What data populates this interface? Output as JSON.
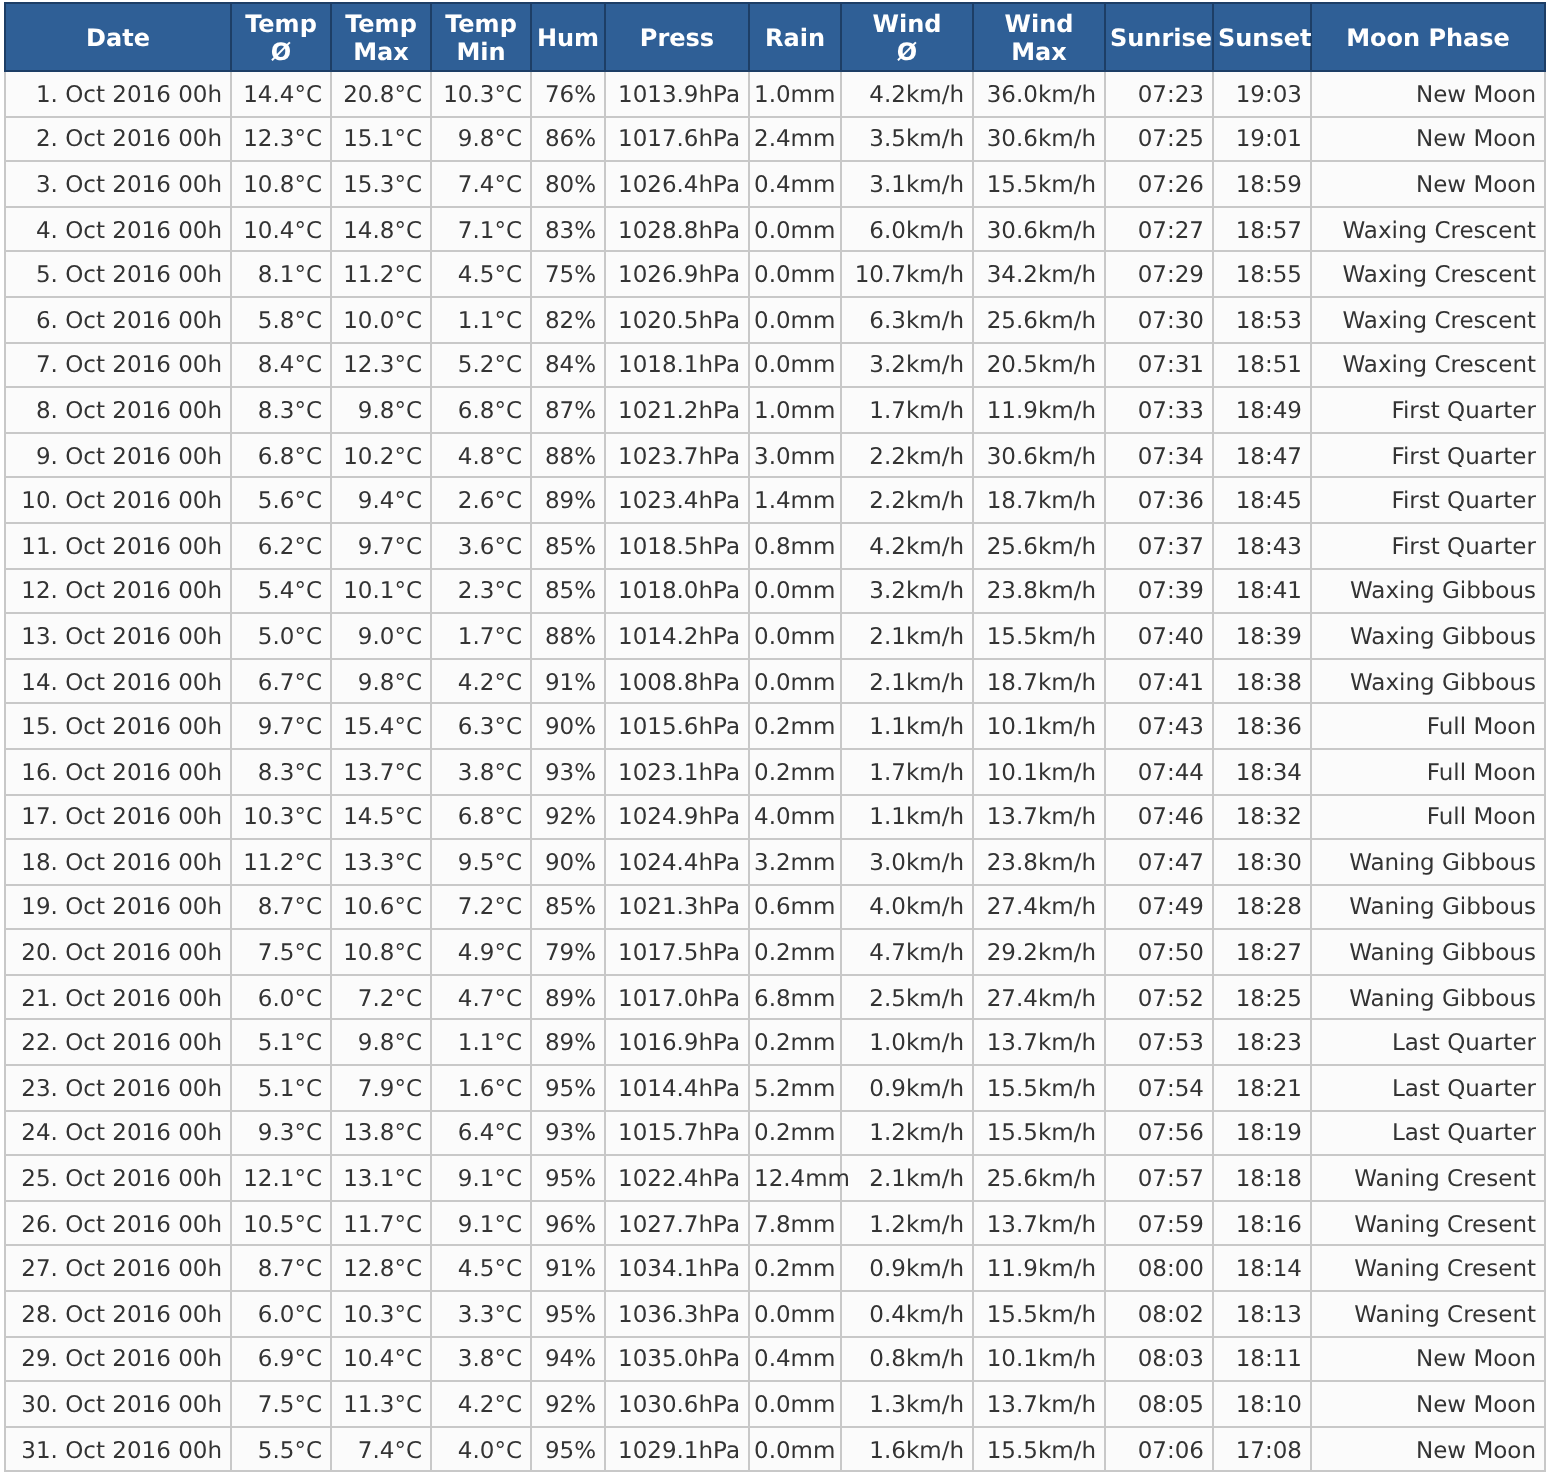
{
  "table": {
    "columns": [
      "Date",
      "Temp Ø",
      "Temp Max",
      "Temp Min",
      "Hum",
      "Press",
      "Rain",
      "Wind Ø",
      "Wind Max",
      "Sunrise",
      "Sunset",
      "Moon Phase"
    ],
    "rows": [
      [
        "1. Oct 2016 00h",
        "14.4°C",
        "20.8°C",
        "10.3°C",
        "76%",
        "1013.9hPa",
        "1.0mm",
        "4.2km/h",
        "36.0km/h",
        "07:23",
        "19:03",
        "New Moon"
      ],
      [
        "2. Oct 2016 00h",
        "12.3°C",
        "15.1°C",
        "9.8°C",
        "86%",
        "1017.6hPa",
        "2.4mm",
        "3.5km/h",
        "30.6km/h",
        "07:25",
        "19:01",
        "New Moon"
      ],
      [
        "3. Oct 2016 00h",
        "10.8°C",
        "15.3°C",
        "7.4°C",
        "80%",
        "1026.4hPa",
        "0.4mm",
        "3.1km/h",
        "15.5km/h",
        "07:26",
        "18:59",
        "New Moon"
      ],
      [
        "4. Oct 2016 00h",
        "10.4°C",
        "14.8°C",
        "7.1°C",
        "83%",
        "1028.8hPa",
        "0.0mm",
        "6.0km/h",
        "30.6km/h",
        "07:27",
        "18:57",
        "Waxing Crescent"
      ],
      [
        "5. Oct 2016 00h",
        "8.1°C",
        "11.2°C",
        "4.5°C",
        "75%",
        "1026.9hPa",
        "0.0mm",
        "10.7km/h",
        "34.2km/h",
        "07:29",
        "18:55",
        "Waxing Crescent"
      ],
      [
        "6. Oct 2016 00h",
        "5.8°C",
        "10.0°C",
        "1.1°C",
        "82%",
        "1020.5hPa",
        "0.0mm",
        "6.3km/h",
        "25.6km/h",
        "07:30",
        "18:53",
        "Waxing Crescent"
      ],
      [
        "7. Oct 2016 00h",
        "8.4°C",
        "12.3°C",
        "5.2°C",
        "84%",
        "1018.1hPa",
        "0.0mm",
        "3.2km/h",
        "20.5km/h",
        "07:31",
        "18:51",
        "Waxing Crescent"
      ],
      [
        "8. Oct 2016 00h",
        "8.3°C",
        "9.8°C",
        "6.8°C",
        "87%",
        "1021.2hPa",
        "1.0mm",
        "1.7km/h",
        "11.9km/h",
        "07:33",
        "18:49",
        "First Quarter"
      ],
      [
        "9. Oct 2016 00h",
        "6.8°C",
        "10.2°C",
        "4.8°C",
        "88%",
        "1023.7hPa",
        "3.0mm",
        "2.2km/h",
        "30.6km/h",
        "07:34",
        "18:47",
        "First Quarter"
      ],
      [
        "10. Oct 2016 00h",
        "5.6°C",
        "9.4°C",
        "2.6°C",
        "89%",
        "1023.4hPa",
        "1.4mm",
        "2.2km/h",
        "18.7km/h",
        "07:36",
        "18:45",
        "First Quarter"
      ],
      [
        "11. Oct 2016 00h",
        "6.2°C",
        "9.7°C",
        "3.6°C",
        "85%",
        "1018.5hPa",
        "0.8mm",
        "4.2km/h",
        "25.6km/h",
        "07:37",
        "18:43",
        "First Quarter"
      ],
      [
        "12. Oct 2016 00h",
        "5.4°C",
        "10.1°C",
        "2.3°C",
        "85%",
        "1018.0hPa",
        "0.0mm",
        "3.2km/h",
        "23.8km/h",
        "07:39",
        "18:41",
        "Waxing Gibbous"
      ],
      [
        "13. Oct 2016 00h",
        "5.0°C",
        "9.0°C",
        "1.7°C",
        "88%",
        "1014.2hPa",
        "0.0mm",
        "2.1km/h",
        "15.5km/h",
        "07:40",
        "18:39",
        "Waxing Gibbous"
      ],
      [
        "14. Oct 2016 00h",
        "6.7°C",
        "9.8°C",
        "4.2°C",
        "91%",
        "1008.8hPa",
        "0.0mm",
        "2.1km/h",
        "18.7km/h",
        "07:41",
        "18:38",
        "Waxing Gibbous"
      ],
      [
        "15. Oct 2016 00h",
        "9.7°C",
        "15.4°C",
        "6.3°C",
        "90%",
        "1015.6hPa",
        "0.2mm",
        "1.1km/h",
        "10.1km/h",
        "07:43",
        "18:36",
        "Full Moon"
      ],
      [
        "16. Oct 2016 00h",
        "8.3°C",
        "13.7°C",
        "3.8°C",
        "93%",
        "1023.1hPa",
        "0.2mm",
        "1.7km/h",
        "10.1km/h",
        "07:44",
        "18:34",
        "Full Moon"
      ],
      [
        "17. Oct 2016 00h",
        "10.3°C",
        "14.5°C",
        "6.8°C",
        "92%",
        "1024.9hPa",
        "4.0mm",
        "1.1km/h",
        "13.7km/h",
        "07:46",
        "18:32",
        "Full Moon"
      ],
      [
        "18. Oct 2016 00h",
        "11.2°C",
        "13.3°C",
        "9.5°C",
        "90%",
        "1024.4hPa",
        "3.2mm",
        "3.0km/h",
        "23.8km/h",
        "07:47",
        "18:30",
        "Waning Gibbous"
      ],
      [
        "19. Oct 2016 00h",
        "8.7°C",
        "10.6°C",
        "7.2°C",
        "85%",
        "1021.3hPa",
        "0.6mm",
        "4.0km/h",
        "27.4km/h",
        "07:49",
        "18:28",
        "Waning Gibbous"
      ],
      [
        "20. Oct 2016 00h",
        "7.5°C",
        "10.8°C",
        "4.9°C",
        "79%",
        "1017.5hPa",
        "0.2mm",
        "4.7km/h",
        "29.2km/h",
        "07:50",
        "18:27",
        "Waning Gibbous"
      ],
      [
        "21. Oct 2016 00h",
        "6.0°C",
        "7.2°C",
        "4.7°C",
        "89%",
        "1017.0hPa",
        "6.8mm",
        "2.5km/h",
        "27.4km/h",
        "07:52",
        "18:25",
        "Waning Gibbous"
      ],
      [
        "22. Oct 2016 00h",
        "5.1°C",
        "9.8°C",
        "1.1°C",
        "89%",
        "1016.9hPa",
        "0.2mm",
        "1.0km/h",
        "13.7km/h",
        "07:53",
        "18:23",
        "Last Quarter"
      ],
      [
        "23. Oct 2016 00h",
        "5.1°C",
        "7.9°C",
        "1.6°C",
        "95%",
        "1014.4hPa",
        "5.2mm",
        "0.9km/h",
        "15.5km/h",
        "07:54",
        "18:21",
        "Last Quarter"
      ],
      [
        "24. Oct 2016 00h",
        "9.3°C",
        "13.8°C",
        "6.4°C",
        "93%",
        "1015.7hPa",
        "0.2mm",
        "1.2km/h",
        "15.5km/h",
        "07:56",
        "18:19",
        "Last Quarter"
      ],
      [
        "25. Oct 2016 00h",
        "12.1°C",
        "13.1°C",
        "9.1°C",
        "95%",
        "1022.4hPa",
        "12.4mm",
        "2.1km/h",
        "25.6km/h",
        "07:57",
        "18:18",
        "Waning Cresent"
      ],
      [
        "26. Oct 2016 00h",
        "10.5°C",
        "11.7°C",
        "9.1°C",
        "96%",
        "1027.7hPa",
        "7.8mm",
        "1.2km/h",
        "13.7km/h",
        "07:59",
        "18:16",
        "Waning Cresent"
      ],
      [
        "27. Oct 2016 00h",
        "8.7°C",
        "12.8°C",
        "4.5°C",
        "91%",
        "1034.1hPa",
        "0.2mm",
        "0.9km/h",
        "11.9km/h",
        "08:00",
        "18:14",
        "Waning Cresent"
      ],
      [
        "28. Oct 2016 00h",
        "6.0°C",
        "10.3°C",
        "3.3°C",
        "95%",
        "1036.3hPa",
        "0.0mm",
        "0.4km/h",
        "15.5km/h",
        "08:02",
        "18:13",
        "Waning Cresent"
      ],
      [
        "29. Oct 2016 00h",
        "6.9°C",
        "10.4°C",
        "3.8°C",
        "94%",
        "1035.0hPa",
        "0.4mm",
        "0.8km/h",
        "10.1km/h",
        "08:03",
        "18:11",
        "New Moon"
      ],
      [
        "30. Oct 2016 00h",
        "7.5°C",
        "11.3°C",
        "4.2°C",
        "92%",
        "1030.6hPa",
        "0.0mm",
        "1.3km/h",
        "13.7km/h",
        "08:05",
        "18:10",
        "New Moon"
      ],
      [
        "31. Oct 2016 00h",
        "5.5°C",
        "7.4°C",
        "4.0°C",
        "95%",
        "1029.1hPa",
        "0.0mm",
        "1.6km/h",
        "15.5km/h",
        "07:06",
        "17:08",
        "New Moon"
      ]
    ]
  }
}
